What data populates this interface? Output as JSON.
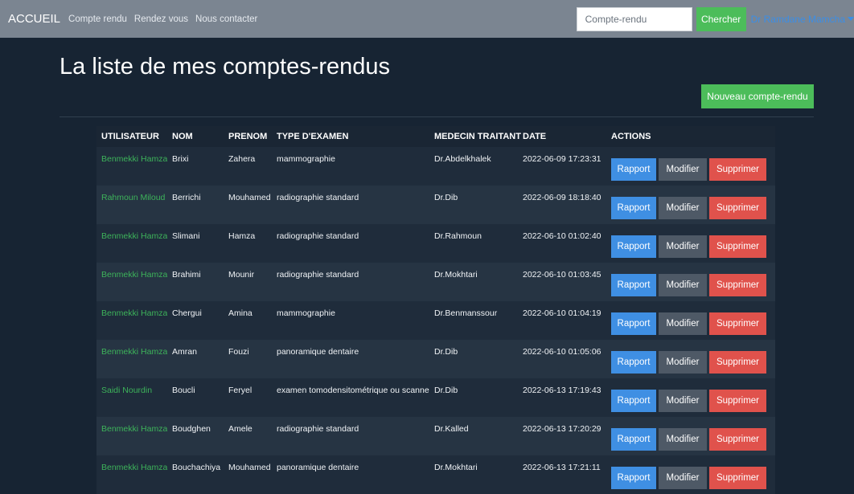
{
  "navbar": {
    "brand": "ACCUEIL",
    "links": [
      "Compte rendu",
      "Rendez vous",
      "Nous contacter"
    ],
    "search_placeholder": "Compte-rendu",
    "search_button": "Chercher",
    "user_name": "Dr Ramdane Mamcha"
  },
  "page": {
    "title": "La liste de mes comptes-rendus",
    "new_button": "Nouveau compte-rendu"
  },
  "colors": {
    "navbar_bg": "#7b8591",
    "page_bg": "#172433",
    "success": "#4cbd5a",
    "primary": "#3f8fe3",
    "secondary": "#4e5966",
    "danger": "#e0524c",
    "user_link": "#3db35a"
  },
  "table": {
    "headers": [
      "UTILISATEUR",
      "NOM",
      "PRENOM",
      "TYPE D'EXAMEN",
      "MEDECIN TRAITANT",
      "DATE",
      "ACTIONS"
    ],
    "actions": {
      "rapport": "Rapport",
      "modifier": "Modifier",
      "supprimer": "Supprimer"
    },
    "rows": [
      {
        "utilisateur": "Benmekki Hamza",
        "nom": "Brixi",
        "prenom": "Zahera",
        "type": "mammographie",
        "medecin": "Dr.Abdelkhalek",
        "date": "2022-06-09 17:23:31"
      },
      {
        "utilisateur": "Rahmoun Miloud",
        "nom": "Berrichi",
        "prenom": "Mouhamed",
        "type": "radiographie standard",
        "medecin": "Dr.Dib",
        "date": "2022-06-09 18:18:40"
      },
      {
        "utilisateur": "Benmekki Hamza",
        "nom": "Slimani",
        "prenom": "Hamza",
        "type": "radiographie standard",
        "medecin": "Dr.Rahmoun",
        "date": "2022-06-10 01:02:40"
      },
      {
        "utilisateur": "Benmekki Hamza",
        "nom": "Brahimi",
        "prenom": "Mounir",
        "type": "radiographie standard",
        "medecin": "Dr.Mokhtari",
        "date": "2022-06-10 01:03:45"
      },
      {
        "utilisateur": "Benmekki Hamza",
        "nom": "Chergui",
        "prenom": "Amina",
        "type": "mammographie",
        "medecin": "Dr.Benmanssour",
        "date": "2022-06-10 01:04:19"
      },
      {
        "utilisateur": "Benmekki Hamza",
        "nom": "Amran",
        "prenom": "Fouzi",
        "type": "panoramique dentaire",
        "medecin": "Dr.Dib",
        "date": "2022-06-10 01:05:06"
      },
      {
        "utilisateur": "Saidi Nourdin",
        "nom": "Boucli",
        "prenom": "Feryel",
        "type": "examen tomodensitométrique ou scanner",
        "medecin": "Dr.Dib",
        "date": "2022-06-13 17:19:43"
      },
      {
        "utilisateur": "Benmekki Hamza",
        "nom": "Boudghen",
        "prenom": "Amele",
        "type": "radiographie standard",
        "medecin": "Dr.Kalled",
        "date": "2022-06-13 17:20:29"
      },
      {
        "utilisateur": "Benmekki Hamza",
        "nom": "Bouchachiya",
        "prenom": "Mouhamed",
        "type": "panoramique dentaire",
        "medecin": "Dr.Mokhtari",
        "date": "2022-06-13 17:21:11"
      }
    ]
  }
}
